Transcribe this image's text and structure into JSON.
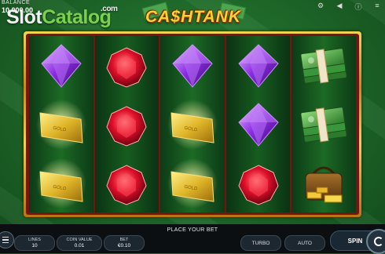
{
  "balance": {
    "label": "BALANCE",
    "value": "10,000.00"
  },
  "watermark": {
    "part1": "Slot",
    "part2": "Catalog",
    "suffix": ".com"
  },
  "logo": {
    "text": "CA$HTANK"
  },
  "top_icons": [
    "settings-icon",
    "sound-icon",
    "info-icon",
    "menu-icon"
  ],
  "status": {
    "message": "PLACE YOUR BET"
  },
  "controls": {
    "lines": {
      "label": "LINES",
      "value": "10"
    },
    "coin_value": {
      "label": "COIN VALUE",
      "value": "0.01"
    },
    "bet": {
      "label": "BET",
      "value": "€0.10"
    },
    "turbo_label": "TURBO",
    "auto_label": "AUTO",
    "spin_label": "SPIN"
  },
  "reels": [
    [
      "purple-gem",
      "gold-bar",
      "gold-bar"
    ],
    [
      "red-gem",
      "red-gem",
      "red-gem"
    ],
    [
      "purple-gem",
      "gold-bar",
      "gold-bar"
    ],
    [
      "purple-gem",
      "purple-gem",
      "red-gem"
    ],
    [
      "cash-stack",
      "cash-stack",
      "gold-bag"
    ]
  ],
  "gold_bar_text": "GOLD",
  "colors": {
    "frame_gold": "#f2d54e",
    "reel_green": "#1c6a25",
    "logo_yellow": "#f9d23a"
  }
}
